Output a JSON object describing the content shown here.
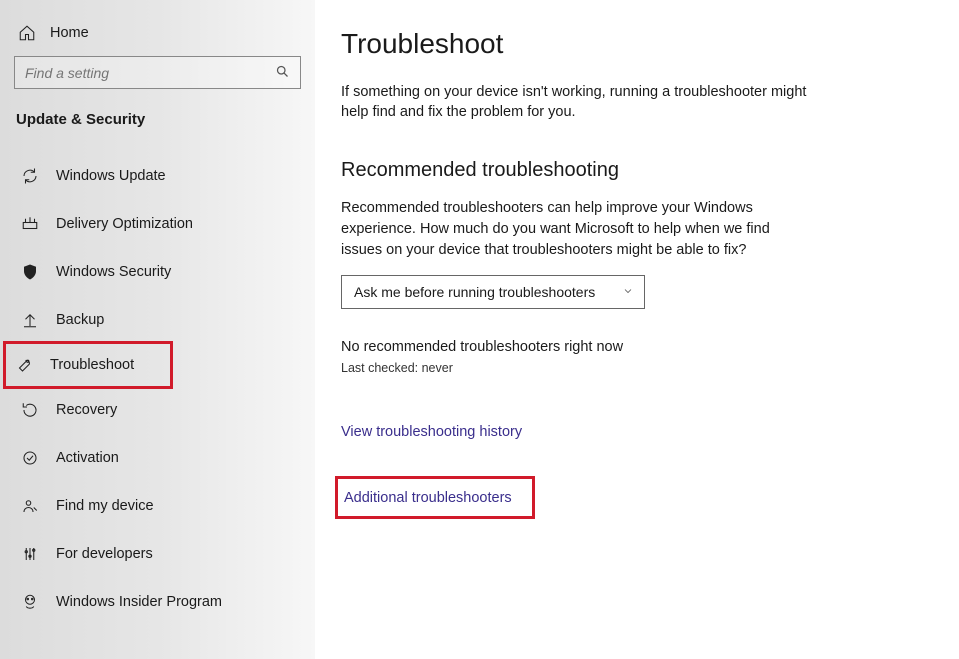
{
  "sidebar": {
    "home": "Home",
    "search_placeholder": "Find a setting",
    "section": "Update & Security",
    "items": [
      {
        "label": "Windows Update"
      },
      {
        "label": "Delivery Optimization"
      },
      {
        "label": "Windows Security"
      },
      {
        "label": "Backup"
      },
      {
        "label": "Troubleshoot"
      },
      {
        "label": "Recovery"
      },
      {
        "label": "Activation"
      },
      {
        "label": "Find my device"
      },
      {
        "label": "For developers"
      },
      {
        "label": "Windows Insider Program"
      }
    ]
  },
  "main": {
    "title": "Troubleshoot",
    "intro": "If something on your device isn't working, running a troubleshooter might help find and fix the problem for you.",
    "rec_heading": "Recommended troubleshooting",
    "rec_desc": "Recommended troubleshooters can help improve your Windows experience. How much do you want Microsoft to help when we find issues on your device that troubleshooters might be able to fix?",
    "dropdown_value": "Ask me before running troubleshooters",
    "status": "No recommended troubleshooters right now",
    "last_checked": "Last checked: never",
    "history_link": "View troubleshooting history",
    "additional_link": "Additional troubleshooters"
  }
}
